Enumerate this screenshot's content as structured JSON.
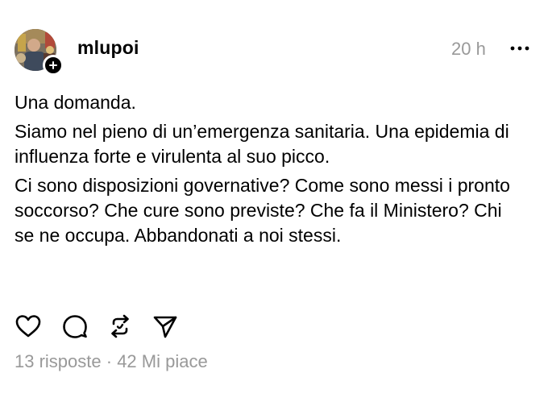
{
  "post": {
    "author": {
      "username": "mlupoi"
    },
    "time": "20 h",
    "paragraphs": [
      "Una domanda.",
      "Siamo nel pieno di un’emergenza sanitaria. Una epidemia di influenza forte e virulenta al suo picco.",
      "Ci sono disposizioni governative? Come sono messi i pronto soccorso? Che cure sono previste? Che fa il Ministero? Chi se ne occupa. Abbandonati a noi stessi."
    ],
    "stats": {
      "replies": "13 risposte",
      "separator": " · ",
      "likes": "42 Mi piace"
    }
  },
  "icons": [
    "heart-icon",
    "comment-icon",
    "repost-icon",
    "share-icon",
    "more-icon",
    "plus-icon"
  ],
  "colors": {
    "text": "#000000",
    "muted": "#999999",
    "background": "#ffffff"
  }
}
